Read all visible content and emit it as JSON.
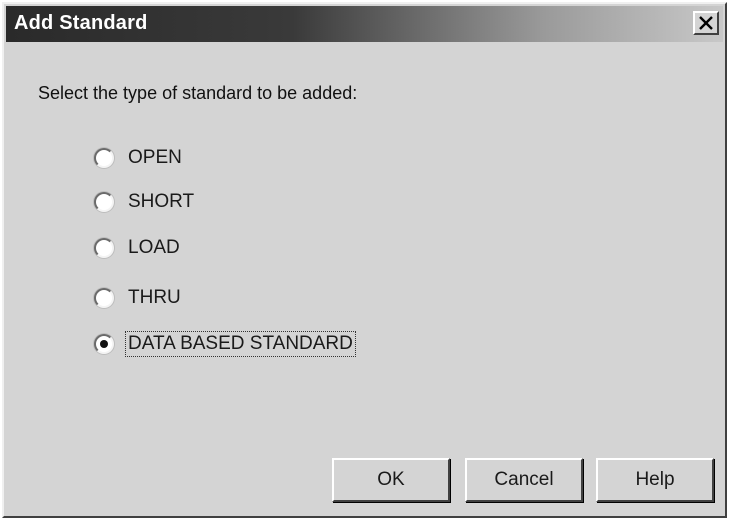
{
  "dialog": {
    "title": "Add Standard",
    "prompt": "Select the type of standard to be added:",
    "options": [
      {
        "label": "OPEN",
        "selected": false
      },
      {
        "label": "SHORT",
        "selected": false
      },
      {
        "label": "LOAD",
        "selected": false
      },
      {
        "label": "THRU",
        "selected": false
      },
      {
        "label": "DATA BASED STANDARD",
        "selected": true
      }
    ],
    "buttons": {
      "ok": "OK",
      "cancel": "Cancel",
      "help": "Help"
    }
  },
  "icons": {
    "close": "close-icon"
  }
}
